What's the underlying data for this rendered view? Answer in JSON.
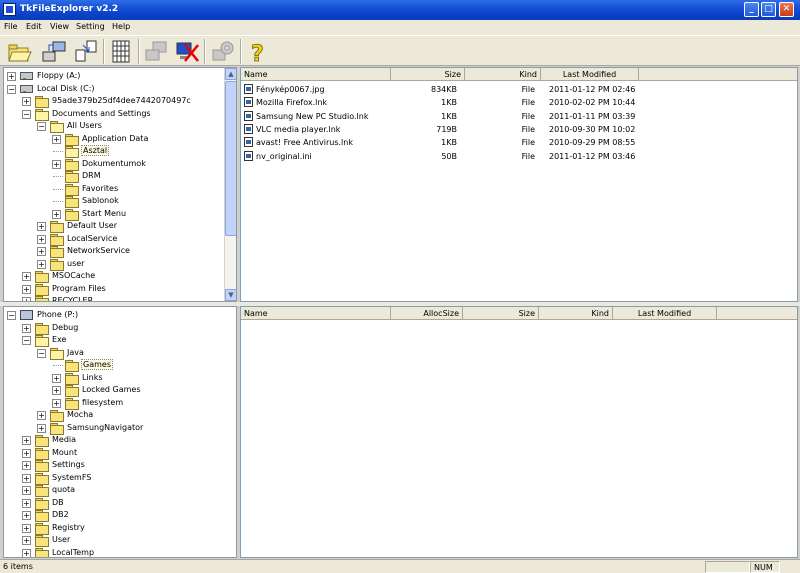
{
  "window": {
    "title": "TkFileExplorer v2.2"
  },
  "menu": [
    "File",
    "Edit",
    "View",
    "Setting",
    "Help"
  ],
  "toolbar": {
    "buttons": [
      {
        "icon": "open-folder-icon"
      },
      {
        "icon": "connect-icon"
      },
      {
        "icon": "transfer-icon"
      },
      {
        "icon": "grid-view-icon"
      },
      {
        "icon": "network-icon"
      },
      {
        "icon": "disconnect-icon"
      },
      {
        "icon": "settings-gear-icon"
      },
      {
        "icon": "help-icon"
      }
    ]
  },
  "local_tree": [
    {
      "label": "Floppy (A:)",
      "depth": 0,
      "exp": "+",
      "type": "floppy"
    },
    {
      "label": "Local Disk (C:)",
      "depth": 0,
      "exp": "-",
      "type": "drive"
    },
    {
      "label": "95ade379b25df4dee7442070497c",
      "depth": 1,
      "exp": "+",
      "type": "folder"
    },
    {
      "label": "Documents and Settings",
      "depth": 1,
      "exp": "-",
      "type": "folder-open"
    },
    {
      "label": "All Users",
      "depth": 2,
      "exp": "-",
      "type": "folder-open"
    },
    {
      "label": "Application Data",
      "depth": 3,
      "exp": "+",
      "type": "folder"
    },
    {
      "label": "Asztal",
      "depth": 3,
      "exp": "",
      "type": "folder-open",
      "selected": true
    },
    {
      "label": "Dokumentumok",
      "depth": 3,
      "exp": "+",
      "type": "folder"
    },
    {
      "label": "DRM",
      "depth": 3,
      "exp": "",
      "type": "folder"
    },
    {
      "label": "Favorites",
      "depth": 3,
      "exp": "",
      "type": "folder"
    },
    {
      "label": "Sablonok",
      "depth": 3,
      "exp": "",
      "type": "folder"
    },
    {
      "label": "Start Menu",
      "depth": 3,
      "exp": "+",
      "type": "folder"
    },
    {
      "label": "Default User",
      "depth": 2,
      "exp": "+",
      "type": "folder"
    },
    {
      "label": "LocalService",
      "depth": 2,
      "exp": "+",
      "type": "folder"
    },
    {
      "label": "NetworkService",
      "depth": 2,
      "exp": "+",
      "type": "folder"
    },
    {
      "label": "user",
      "depth": 2,
      "exp": "+",
      "type": "folder"
    },
    {
      "label": "MSOCache",
      "depth": 1,
      "exp": "+",
      "type": "folder"
    },
    {
      "label": "Program Files",
      "depth": 1,
      "exp": "+",
      "type": "folder"
    },
    {
      "label": "RECYCLER",
      "depth": 1,
      "exp": "+",
      "type": "folder"
    }
  ],
  "local_files": {
    "columns": [
      "Name",
      "Size",
      "Kind",
      "Last Modified"
    ],
    "rows": [
      {
        "name": "Fénykép0067.jpg",
        "size": "834KB",
        "kind": "File",
        "modified": "2011-01-12 PM 02:46"
      },
      {
        "name": "Mozilla Firefox.lnk",
        "size": "1KB",
        "kind": "File",
        "modified": "2010-02-02 PM 10:44"
      },
      {
        "name": "Samsung New PC Studio.lnk",
        "size": "1KB",
        "kind": "File",
        "modified": "2011-01-11 PM 03:39"
      },
      {
        "name": "VLC media player.lnk",
        "size": "719B",
        "kind": "File",
        "modified": "2010-09-30 PM 10:02"
      },
      {
        "name": "avast! Free Antivirus.lnk",
        "size": "1KB",
        "kind": "File",
        "modified": "2010-09-29 PM 08:55"
      },
      {
        "name": "nv_original.ini",
        "size": "50B",
        "kind": "File",
        "modified": "2011-01-12 PM 03:46"
      }
    ]
  },
  "phone_tree": [
    {
      "label": "Phone (P:)",
      "depth": 0,
      "exp": "-",
      "type": "phone"
    },
    {
      "label": "Debug",
      "depth": 1,
      "exp": "+",
      "type": "folder"
    },
    {
      "label": "Exe",
      "depth": 1,
      "exp": "-",
      "type": "folder-open"
    },
    {
      "label": "Java",
      "depth": 2,
      "exp": "-",
      "type": "folder-open"
    },
    {
      "label": "Games",
      "depth": 3,
      "exp": "",
      "type": "folder",
      "selected": true
    },
    {
      "label": "Links",
      "depth": 3,
      "exp": "+",
      "type": "folder"
    },
    {
      "label": "Locked Games",
      "depth": 3,
      "exp": "+",
      "type": "folder"
    },
    {
      "label": "filesystem",
      "depth": 3,
      "exp": "+",
      "type": "folder"
    },
    {
      "label": "Mocha",
      "depth": 2,
      "exp": "+",
      "type": "folder"
    },
    {
      "label": "SamsungNavigator",
      "depth": 2,
      "exp": "+",
      "type": "folder"
    },
    {
      "label": "Media",
      "depth": 1,
      "exp": "+",
      "type": "folder"
    },
    {
      "label": "Mount",
      "depth": 1,
      "exp": "+",
      "type": "folder"
    },
    {
      "label": "Settings",
      "depth": 1,
      "exp": "+",
      "type": "folder"
    },
    {
      "label": "SystemFS",
      "depth": 1,
      "exp": "+",
      "type": "folder"
    },
    {
      "label": "quota",
      "depth": 1,
      "exp": "+",
      "type": "folder"
    },
    {
      "label": "DB",
      "depth": 1,
      "exp": "+",
      "type": "folder"
    },
    {
      "label": "DB2",
      "depth": 1,
      "exp": "+",
      "type": "folder"
    },
    {
      "label": "Registry",
      "depth": 1,
      "exp": "+",
      "type": "folder"
    },
    {
      "label": "User",
      "depth": 1,
      "exp": "+",
      "type": "folder"
    },
    {
      "label": "LocalTemp",
      "depth": 1,
      "exp": "+",
      "type": "folder"
    }
  ],
  "phone_files": {
    "columns": [
      "Name",
      "AllocSize",
      "Size",
      "Kind",
      "Last Modified"
    ],
    "rows": []
  },
  "status": {
    "text": "6 items",
    "num": "NUM"
  }
}
